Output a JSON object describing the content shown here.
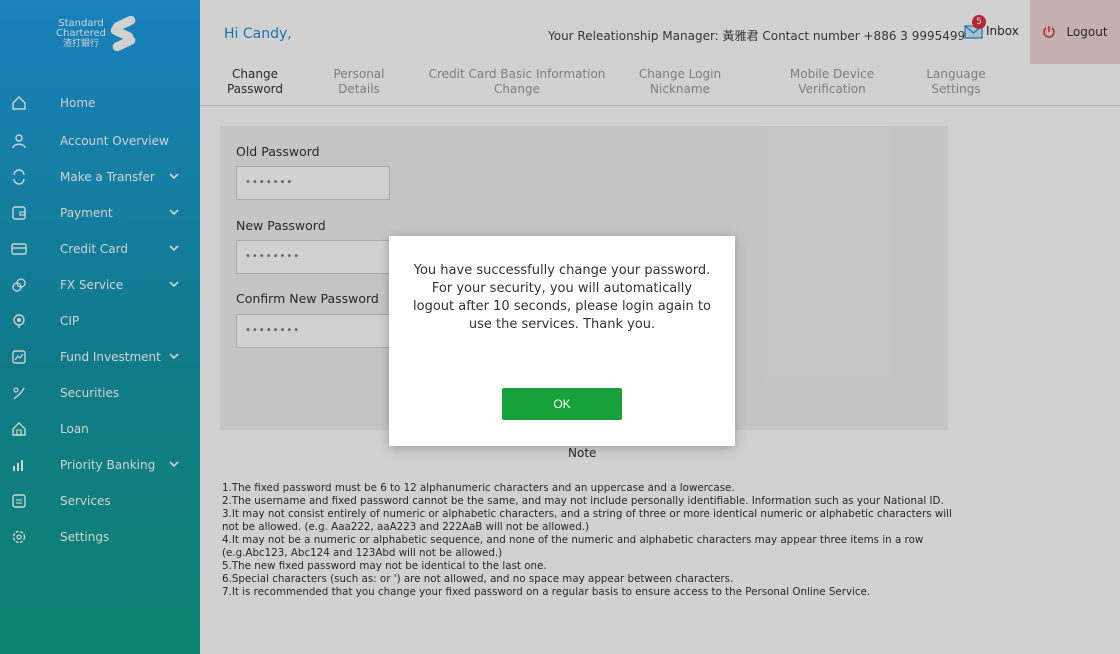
{
  "brand": {
    "line1": "Standard",
    "line2": "Chartered",
    "line3": "渣打銀行"
  },
  "sidebar": {
    "items": [
      {
        "label": "Home",
        "icon": "home-icon"
      },
      {
        "label": "Account Overview",
        "icon": "user-icon"
      },
      {
        "label": "Make a Transfer",
        "icon": "transfer-icon",
        "expandable": true
      },
      {
        "label": "Payment",
        "icon": "payment-icon",
        "expandable": true
      },
      {
        "label": "Credit Card",
        "icon": "credit-card-icon",
        "expandable": true
      },
      {
        "label": "FX Service",
        "icon": "fx-icon",
        "expandable": true
      },
      {
        "label": "CIP",
        "icon": "cip-icon"
      },
      {
        "label": "Fund Investment",
        "icon": "fund-icon",
        "expandable": true
      },
      {
        "label": "Securities",
        "icon": "securities-icon"
      },
      {
        "label": "Loan",
        "icon": "loan-icon"
      },
      {
        "label": "Priority Banking",
        "icon": "priority-icon",
        "expandable": true
      },
      {
        "label": "Services",
        "icon": "services-icon"
      },
      {
        "label": "Settings",
        "icon": "settings-icon"
      }
    ]
  },
  "header": {
    "greeting": "Hi Candy,",
    "relationship_manager": "Your Releationship Manager: 黃雅君 Contact number +886 3 9995499",
    "inbox_label": "Inbox",
    "inbox_count": "5",
    "logout_label": "Logout"
  },
  "tabs": [
    {
      "line1": "Change",
      "line2": "Password",
      "active": true
    },
    {
      "line1": "Personal",
      "line2": "Details"
    },
    {
      "line1": "Credit Card Basic Information",
      "line2": "Change"
    },
    {
      "line1": "Change Login",
      "line2": "Nickname"
    },
    {
      "line1": "Mobile Device",
      "line2": "Verification"
    },
    {
      "line1": "Language",
      "line2": "Settings"
    }
  ],
  "form": {
    "old_password_label": "Old Password",
    "old_password_value": "•••••••",
    "new_password_label": "New Password",
    "new_password_value": "••••••••",
    "confirm_password_label": "Confirm New Password",
    "confirm_password_value": "••••••••"
  },
  "note": {
    "title": "Note",
    "lines": [
      "1.The fixed password must be 6 to 12 alphanumeric characters and an uppercase and a lowercase.",
      "2.The username and fixed password cannot be the same, and may not include personally identifiable. Information such as your National ID.",
      "3.It may not consist entirely of numeric or alphabetic characters, and a string of three or more identical numeric or alphabetic characters will not be allowed. (e.g. Aaa222, aaA223 and 222AaB will not be allowed.)",
      "4.It may not be a numeric or alphabetic sequence, and none of the numeric and alphabetic characters may appear three items in a row (e.g.Abc123, Abc124 and 123Abd will not be allowed.)",
      "5.The new fixed password may not be identical to the last one.",
      "6.Special characters (such as: or ') are not allowed, and no space may appear between characters.",
      "7.It is recommended that you change your fixed password on a regular basis to ensure access to the Personal Online Service."
    ]
  },
  "modal": {
    "message": "You have successfully change your password. For your security, you will automatically logout after 10 seconds, please login again to use the services. Thank you.",
    "ok_label": "OK"
  },
  "colors": {
    "accent": "#1a8fd6",
    "ok_button": "#18a03a",
    "logout_bg": "#f3d6d6",
    "badge": "#d8323c"
  }
}
